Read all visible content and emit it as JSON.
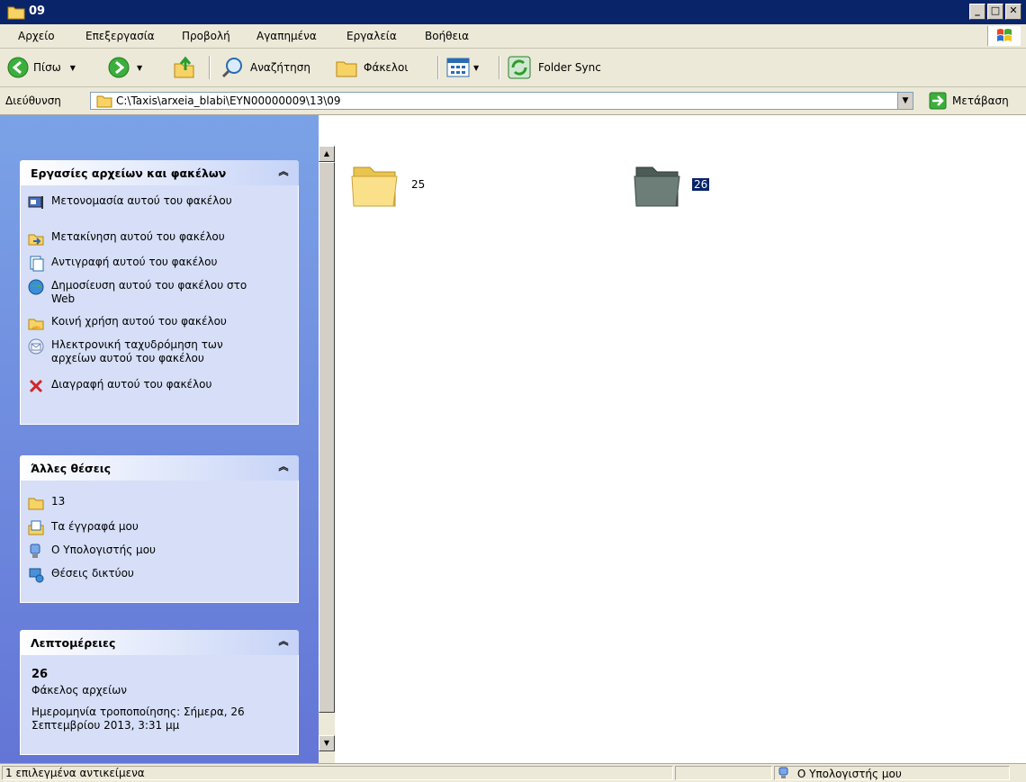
{
  "window": {
    "title": "09"
  },
  "menu": {
    "items": [
      "Αρχείο",
      "Επεξεργασία",
      "Προβολή",
      "Αγαπημένα",
      "Εργαλεία",
      "Βοήθεια"
    ]
  },
  "toolbar": {
    "back_label": "Πίσω",
    "search_label": "Αναζήτηση",
    "folders_label": "Φάκελοι",
    "folder_sync_label": "Folder Sync"
  },
  "address": {
    "label": "Διεύθυνση",
    "path": "C:\\Taxis\\arxeia_blabi\\EYN00000009\\13\\09",
    "go_label": "Μετάβαση"
  },
  "tasks_panel": {
    "title": "Εργασίες αρχείων και φακέλων",
    "items": [
      {
        "label": "Μετονομασία αυτού του φακέλου",
        "icon": "rename-icon"
      },
      {
        "label": "Μετακίνηση αυτού του φακέλου",
        "icon": "move-folder-icon"
      },
      {
        "label": "Αντιγραφή αυτού του φακέλου",
        "icon": "copy-icon"
      },
      {
        "label": "Δημοσίευση αυτού του φακέλου στο Web",
        "icon": "publish-web-icon"
      },
      {
        "label": "Κοινή χρήση αυτού του φακέλου",
        "icon": "share-folder-icon"
      },
      {
        "label": "Ηλεκτρονική ταχυδρόμηση των αρχείων αυτού του φακέλου",
        "icon": "email-icon"
      },
      {
        "label": "Διαγραφή αυτού του φακέλου",
        "icon": "delete-icon"
      }
    ]
  },
  "places_panel": {
    "title": "Άλλες θέσεις",
    "items": [
      {
        "label": "13",
        "icon": "folder-icon"
      },
      {
        "label": "Τα έγγραφά μου",
        "icon": "my-documents-icon"
      },
      {
        "label": "Ο Υπολογιστής μου",
        "icon": "my-computer-icon"
      },
      {
        "label": "Θέσεις δικτύου",
        "icon": "network-places-icon"
      }
    ]
  },
  "details_panel": {
    "title": "Λεπτομέρειες",
    "name": "26",
    "type": "Φάκελος αρχείων",
    "modified": "Ημερομηνία τροποποίησης: Σήμερα, 26 Σεπτεμβρίου 2013, 3:31 μμ"
  },
  "content": {
    "folders": [
      {
        "name": "25",
        "selected": false
      },
      {
        "name": "26",
        "selected": true
      }
    ]
  },
  "status": {
    "selection": "1 επιλεγμένα αντικείμενα",
    "location": "Ο Υπολογιστής μου"
  },
  "colors": {
    "titlebar": "#0a246a",
    "selection": "#0a246a",
    "panel_bg": "#d6dff7",
    "pane_gradient_top": "#7ba2e7"
  }
}
